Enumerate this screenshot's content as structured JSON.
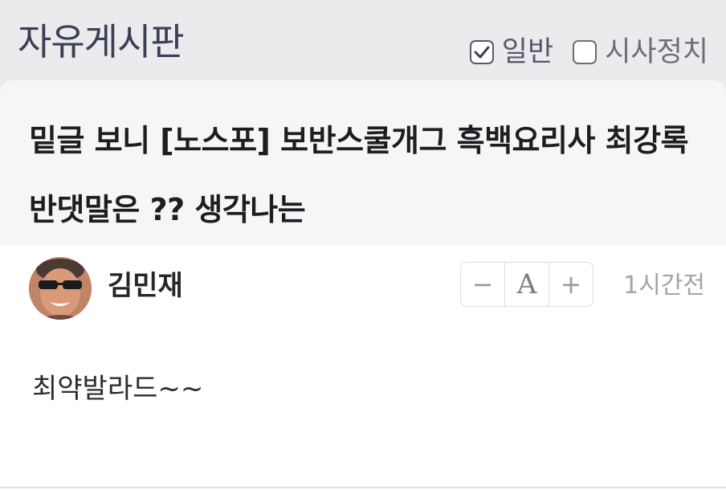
{
  "board": {
    "title": "자유게시판",
    "filters": [
      {
        "label": "일반",
        "checked": true
      },
      {
        "label": "시사정치",
        "checked": false
      }
    ]
  },
  "post": {
    "title": "밑글 보니 [노스포] 보반스쿨개그 흑백요리사 최강록 반댓말은 ?? 생각나는",
    "author": "김민재",
    "time": "1시간전",
    "body": "최약발라드~~",
    "font_controls": {
      "decrease": "−",
      "font": "A",
      "increase": "+"
    }
  },
  "colors": {
    "background": "#ebebed",
    "title_card": "#f6f6f7",
    "board_title": "#3a3f55"
  }
}
